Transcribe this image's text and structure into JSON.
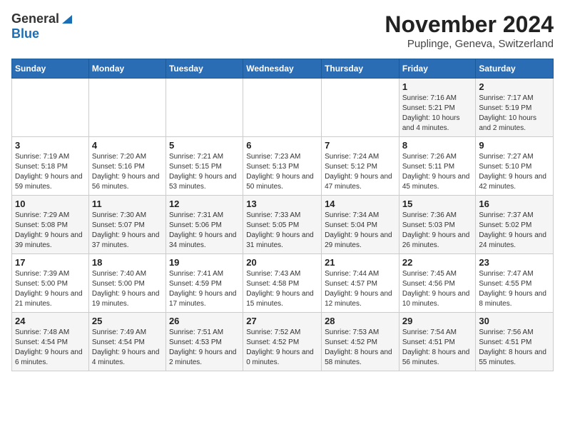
{
  "header": {
    "logo_general": "General",
    "logo_blue": "Blue",
    "month_title": "November 2024",
    "subtitle": "Puplinge, Geneva, Switzerland"
  },
  "days_of_week": [
    "Sunday",
    "Monday",
    "Tuesday",
    "Wednesday",
    "Thursday",
    "Friday",
    "Saturday"
  ],
  "weeks": [
    [
      {
        "day": "",
        "info": ""
      },
      {
        "day": "",
        "info": ""
      },
      {
        "day": "",
        "info": ""
      },
      {
        "day": "",
        "info": ""
      },
      {
        "day": "",
        "info": ""
      },
      {
        "day": "1",
        "info": "Sunrise: 7:16 AM\nSunset: 5:21 PM\nDaylight: 10 hours and 4 minutes."
      },
      {
        "day": "2",
        "info": "Sunrise: 7:17 AM\nSunset: 5:19 PM\nDaylight: 10 hours and 2 minutes."
      }
    ],
    [
      {
        "day": "3",
        "info": "Sunrise: 7:19 AM\nSunset: 5:18 PM\nDaylight: 9 hours and 59 minutes."
      },
      {
        "day": "4",
        "info": "Sunrise: 7:20 AM\nSunset: 5:16 PM\nDaylight: 9 hours and 56 minutes."
      },
      {
        "day": "5",
        "info": "Sunrise: 7:21 AM\nSunset: 5:15 PM\nDaylight: 9 hours and 53 minutes."
      },
      {
        "day": "6",
        "info": "Sunrise: 7:23 AM\nSunset: 5:13 PM\nDaylight: 9 hours and 50 minutes."
      },
      {
        "day": "7",
        "info": "Sunrise: 7:24 AM\nSunset: 5:12 PM\nDaylight: 9 hours and 47 minutes."
      },
      {
        "day": "8",
        "info": "Sunrise: 7:26 AM\nSunset: 5:11 PM\nDaylight: 9 hours and 45 minutes."
      },
      {
        "day": "9",
        "info": "Sunrise: 7:27 AM\nSunset: 5:10 PM\nDaylight: 9 hours and 42 minutes."
      }
    ],
    [
      {
        "day": "10",
        "info": "Sunrise: 7:29 AM\nSunset: 5:08 PM\nDaylight: 9 hours and 39 minutes."
      },
      {
        "day": "11",
        "info": "Sunrise: 7:30 AM\nSunset: 5:07 PM\nDaylight: 9 hours and 37 minutes."
      },
      {
        "day": "12",
        "info": "Sunrise: 7:31 AM\nSunset: 5:06 PM\nDaylight: 9 hours and 34 minutes."
      },
      {
        "day": "13",
        "info": "Sunrise: 7:33 AM\nSunset: 5:05 PM\nDaylight: 9 hours and 31 minutes."
      },
      {
        "day": "14",
        "info": "Sunrise: 7:34 AM\nSunset: 5:04 PM\nDaylight: 9 hours and 29 minutes."
      },
      {
        "day": "15",
        "info": "Sunrise: 7:36 AM\nSunset: 5:03 PM\nDaylight: 9 hours and 26 minutes."
      },
      {
        "day": "16",
        "info": "Sunrise: 7:37 AM\nSunset: 5:02 PM\nDaylight: 9 hours and 24 minutes."
      }
    ],
    [
      {
        "day": "17",
        "info": "Sunrise: 7:39 AM\nSunset: 5:00 PM\nDaylight: 9 hours and 21 minutes."
      },
      {
        "day": "18",
        "info": "Sunrise: 7:40 AM\nSunset: 5:00 PM\nDaylight: 9 hours and 19 minutes."
      },
      {
        "day": "19",
        "info": "Sunrise: 7:41 AM\nSunset: 4:59 PM\nDaylight: 9 hours and 17 minutes."
      },
      {
        "day": "20",
        "info": "Sunrise: 7:43 AM\nSunset: 4:58 PM\nDaylight: 9 hours and 15 minutes."
      },
      {
        "day": "21",
        "info": "Sunrise: 7:44 AM\nSunset: 4:57 PM\nDaylight: 9 hours and 12 minutes."
      },
      {
        "day": "22",
        "info": "Sunrise: 7:45 AM\nSunset: 4:56 PM\nDaylight: 9 hours and 10 minutes."
      },
      {
        "day": "23",
        "info": "Sunrise: 7:47 AM\nSunset: 4:55 PM\nDaylight: 9 hours and 8 minutes."
      }
    ],
    [
      {
        "day": "24",
        "info": "Sunrise: 7:48 AM\nSunset: 4:54 PM\nDaylight: 9 hours and 6 minutes."
      },
      {
        "day": "25",
        "info": "Sunrise: 7:49 AM\nSunset: 4:54 PM\nDaylight: 9 hours and 4 minutes."
      },
      {
        "day": "26",
        "info": "Sunrise: 7:51 AM\nSunset: 4:53 PM\nDaylight: 9 hours and 2 minutes."
      },
      {
        "day": "27",
        "info": "Sunrise: 7:52 AM\nSunset: 4:52 PM\nDaylight: 9 hours and 0 minutes."
      },
      {
        "day": "28",
        "info": "Sunrise: 7:53 AM\nSunset: 4:52 PM\nDaylight: 8 hours and 58 minutes."
      },
      {
        "day": "29",
        "info": "Sunrise: 7:54 AM\nSunset: 4:51 PM\nDaylight: 8 hours and 56 minutes."
      },
      {
        "day": "30",
        "info": "Sunrise: 7:56 AM\nSunset: 4:51 PM\nDaylight: 8 hours and 55 minutes."
      }
    ]
  ]
}
